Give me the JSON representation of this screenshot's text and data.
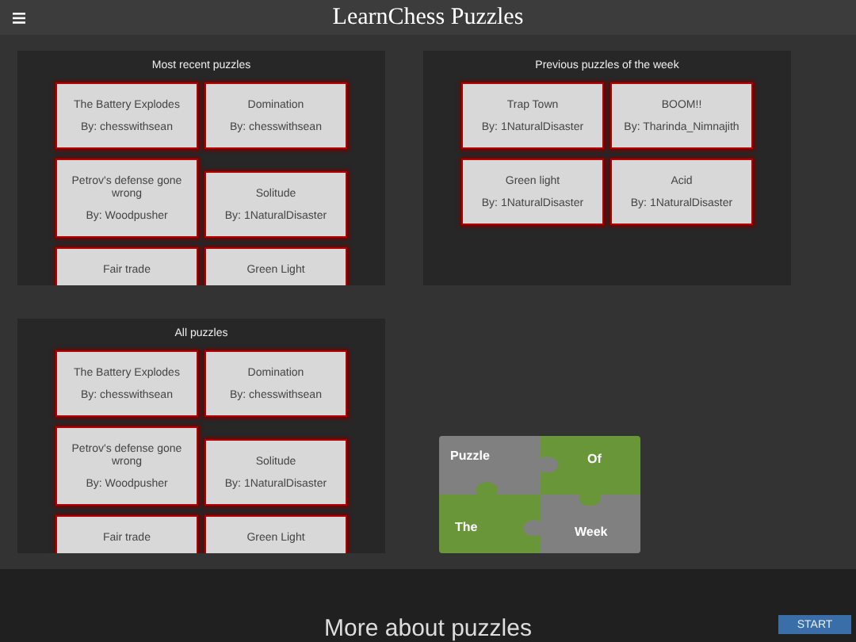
{
  "header": {
    "title": "LearnChess Puzzles"
  },
  "panels": [
    {
      "title": "Most recent puzzles",
      "cards": [
        {
          "title": "The Battery Explodes",
          "author": "By: chesswithsean"
        },
        {
          "title": "Domination",
          "author": "By: chesswithsean"
        },
        {
          "title": "Petrov's defense gone wrong",
          "author": "By: Woodpusher"
        },
        {
          "title": "Solitude",
          "author": "By: 1NaturalDisaster"
        },
        {
          "title": "Fair trade"
        },
        {
          "title": "Green Light"
        }
      ]
    },
    {
      "title": "Previous puzzles of the week",
      "cards": [
        {
          "title": "Trap Town",
          "author": "By: 1NaturalDisaster"
        },
        {
          "title": "BOOM!!",
          "author": "By: Tharinda_Nimnajith"
        },
        {
          "title": "Green light",
          "author": "By: 1NaturalDisaster"
        },
        {
          "title": "Acid",
          "author": "By: 1NaturalDisaster"
        }
      ]
    },
    {
      "title": "All puzzles",
      "cards": [
        {
          "title": "The Battery Explodes",
          "author": "By: chesswithsean"
        },
        {
          "title": "Domination",
          "author": "By: chesswithsean"
        },
        {
          "title": "Petrov's defense gone wrong",
          "author": "By: Woodpusher"
        },
        {
          "title": "Solitude",
          "author": "By: 1NaturalDisaster"
        },
        {
          "title": "Fair trade"
        },
        {
          "title": "Green Light"
        }
      ]
    }
  ],
  "puzzle_of_the_week": {
    "pieces": [
      {
        "label": "Puzzle",
        "color": "#808080"
      },
      {
        "label": "Of",
        "color": "#6a963a"
      },
      {
        "label": "The",
        "color": "#6a963a"
      },
      {
        "label": "Week",
        "color": "#808080"
      }
    ]
  },
  "footer": {
    "heading": "More about puzzles",
    "button": "START"
  }
}
